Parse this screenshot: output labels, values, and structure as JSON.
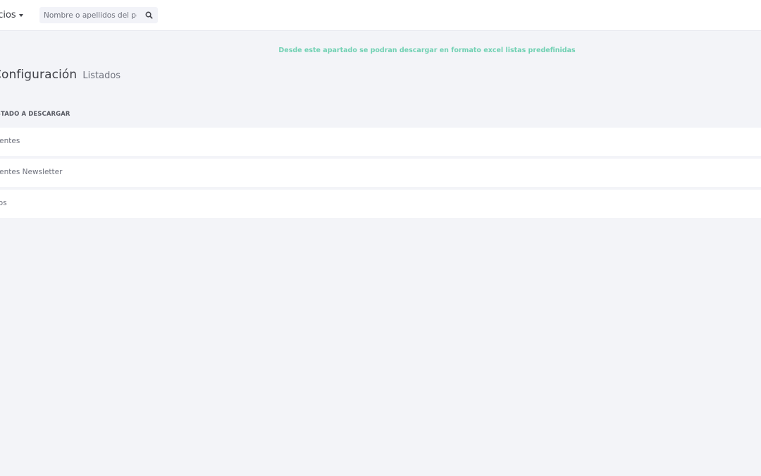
{
  "header": {
    "dropdown_label": "Socios",
    "search": {
      "placeholder": "Nombre o apellidos del porcentaje",
      "value": ""
    }
  },
  "info_text": "Desde este apartado se podran descargar en formato excel listas predefinidas",
  "page": {
    "title": "Configuración",
    "subtitle": "Listados"
  },
  "section_label": "LISTADO A DESCARGAR",
  "items": [
    {
      "label": "Clientes"
    },
    {
      "label": "Clientes Newsletter"
    },
    {
      "label": "Socios"
    }
  ],
  "colors": {
    "accent": "#71d1b3",
    "background": "#f3f4f8",
    "card": "#ffffff"
  }
}
